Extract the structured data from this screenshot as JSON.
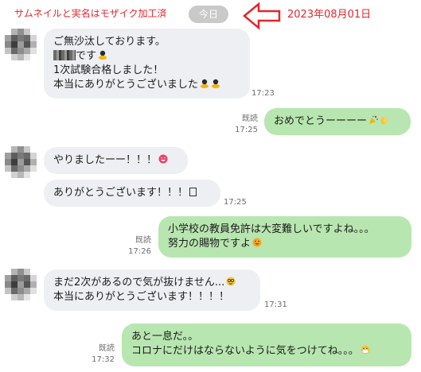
{
  "header": {
    "privacy_note": "サムネイルと実名はモザイク加工済",
    "date_pill": "今日",
    "date_annotation": "2023年08月01日",
    "arrow_color": "#e4262c"
  },
  "colors": {
    "incoming_bubble": "#eeeff2",
    "outgoing_bubble": "#b8e6b0",
    "annotation_red": "#e4262c"
  },
  "messages": [
    {
      "side": "in",
      "lines": [
        "ご無沙汰しております。",
        "です",
        "1次試験合格しました！",
        "本当にありがとうございました"
      ],
      "time": "17:23"
    },
    {
      "side": "out",
      "text": "おめでとうーーーー",
      "read": "既読",
      "time": "17:25"
    },
    {
      "side": "in",
      "text": "やりましたーー！！！"
    },
    {
      "side": "in",
      "text": "ありがとうございます！！！",
      "time": "17:25"
    },
    {
      "side": "out",
      "lines": [
        "小学校の教員免許は大変難しいですよね。。。",
        "努力の賜物ですよ"
      ],
      "read": "既読",
      "time": "17:26"
    },
    {
      "side": "in",
      "lines": [
        "まだ2次があるので気が抜けません...",
        "本当にありがとうございます！！！！"
      ],
      "time": "17:31"
    },
    {
      "side": "out",
      "lines": [
        "あと一息だ。。",
        "コロナにだけはならないように気をつけてね。。。"
      ],
      "read": "既読",
      "time": "17:32"
    }
  ]
}
